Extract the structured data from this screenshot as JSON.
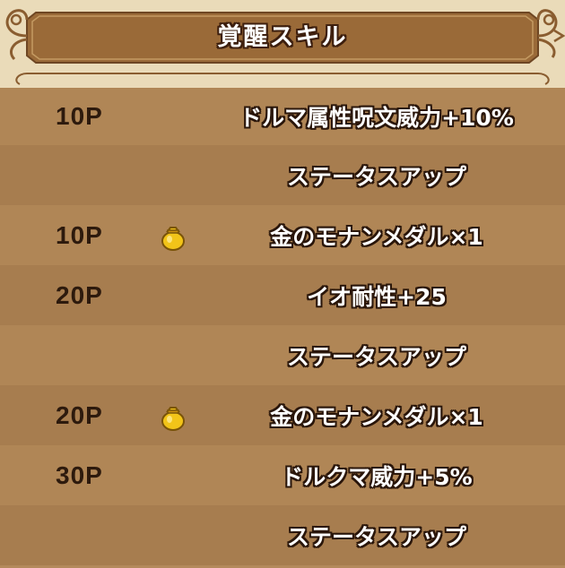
{
  "header": {
    "title": "覚醒スキル"
  },
  "colors": {
    "header_bg": "#eadbb9",
    "banner": "#9a6a38",
    "row_light": "#b08656",
    "row_dark": "#a77d4f",
    "cost_text": "#2d1a0d",
    "skill_text": "#ffffff"
  },
  "rows": [
    {
      "cost": "10P",
      "icon": "",
      "skill": "ドルマ属性呪文威力+10%"
    },
    {
      "cost": "",
      "icon": "",
      "skill": "ステータスアップ"
    },
    {
      "cost": "10P",
      "icon": "gold-bag-icon",
      "skill": "金のモナンメダル×1"
    },
    {
      "cost": "20P",
      "icon": "",
      "skill": "イオ耐性+25"
    },
    {
      "cost": "",
      "icon": "",
      "skill": "ステータスアップ"
    },
    {
      "cost": "20P",
      "icon": "gold-bag-icon",
      "skill": "金のモナンメダル×1"
    },
    {
      "cost": "30P",
      "icon": "",
      "skill": "ドルクマ威力+5%"
    },
    {
      "cost": "",
      "icon": "",
      "skill": "ステータスアップ"
    }
  ]
}
